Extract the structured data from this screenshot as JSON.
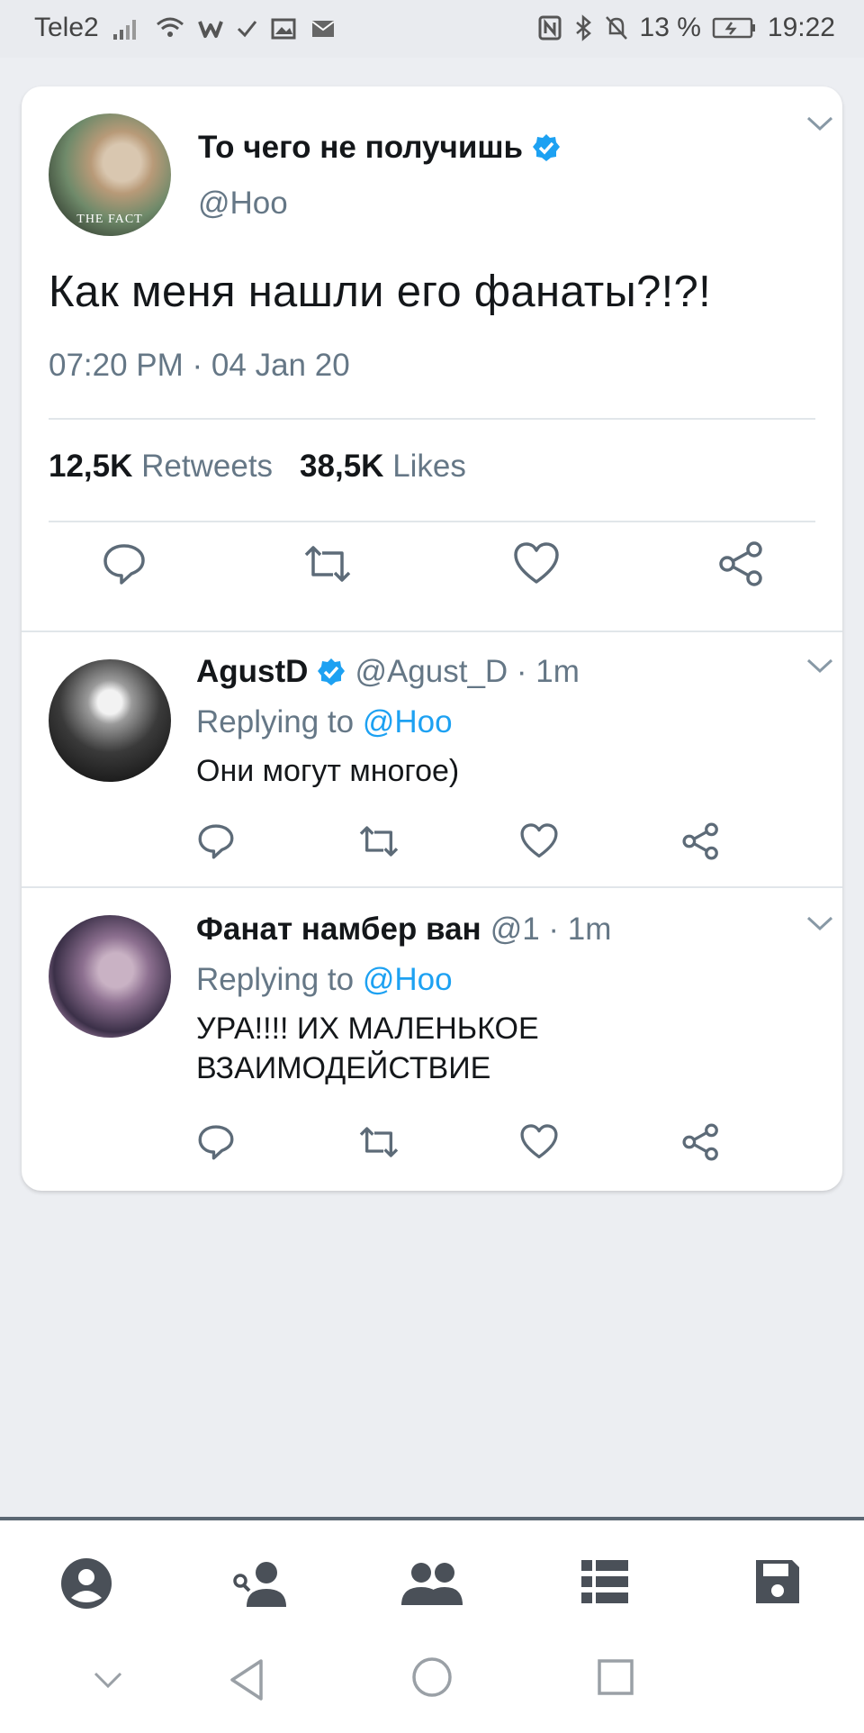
{
  "status_bar": {
    "carrier": "Tele2",
    "battery": "13 %",
    "time": "19:22"
  },
  "main_tweet": {
    "author_name": "То чего не получишь",
    "handle": "@Hoo",
    "avatar_caption": "THE FACT",
    "text": "Как меня нашли его фанаты?!?!",
    "timestamp": "07:20 PM · 04 Jan 20",
    "retweets_count": "12,5K",
    "retweets_label": "Retweets",
    "likes_count": "38,5K",
    "likes_label": "Likes"
  },
  "replies": [
    {
      "author_name": "AgustD",
      "verified": true,
      "handle_time": "@Agust_D · 1m",
      "replying_prefix": "Replying to",
      "replying_handle": "@Hoo",
      "text": "Они могут многое)"
    },
    {
      "author_name": "Фанат намбер ван",
      "verified": false,
      "handle_time": "@1 · 1m",
      "replying_prefix": "Replying to",
      "replying_handle": "@Hoo",
      "text": "УРА!!!! ИХ МАЛЕНЬКОЕ ВЗАИМОДЕЙСТВИЕ"
    }
  ],
  "colors": {
    "accent": "#1da1f2",
    "secondary_text": "#657786",
    "icon": "#5d6b78",
    "nav_icon": "#4a5058"
  },
  "bottom_nav": [
    "profile-icon",
    "find-user-icon",
    "group-icon",
    "list-icon",
    "save-icon"
  ],
  "system_nav": [
    "hide-chevron-icon",
    "back-icon",
    "home-icon",
    "recents-icon"
  ]
}
